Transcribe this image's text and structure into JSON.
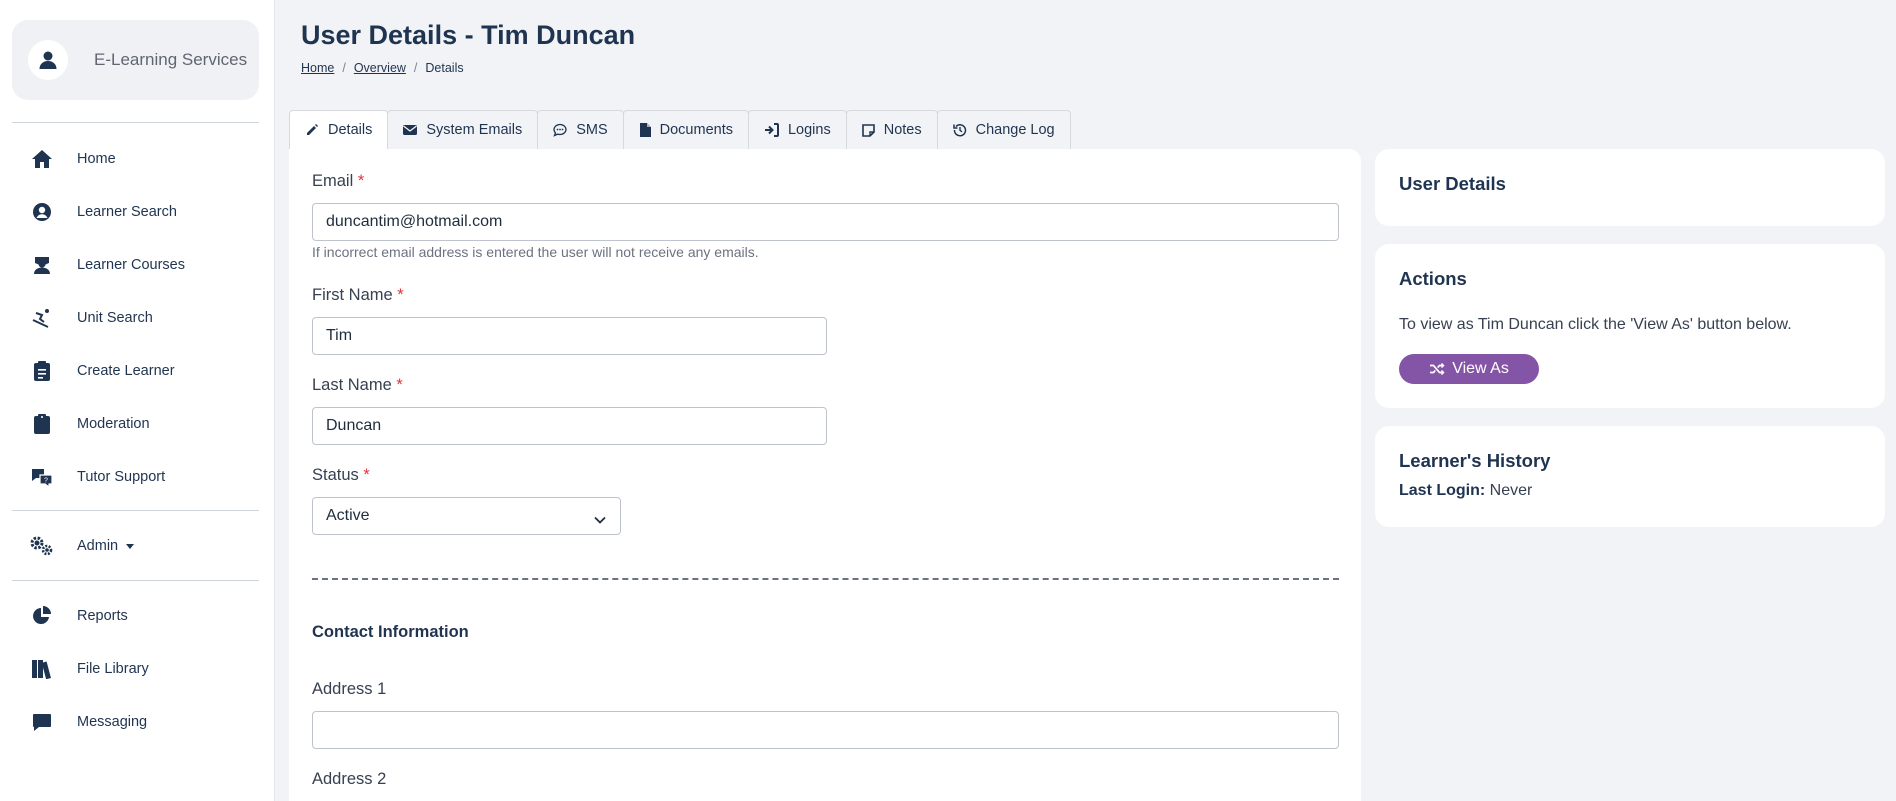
{
  "brand": {
    "name": "E-Learning Services",
    "icon": "user-icon"
  },
  "nav": {
    "items": [
      {
        "label": "Home",
        "icon": "home-icon"
      },
      {
        "label": "Learner Search",
        "icon": "user-circle-icon"
      },
      {
        "label": "Learner Courses",
        "icon": "graduate-icon"
      },
      {
        "label": "Unit Search",
        "icon": "skiing-icon"
      },
      {
        "label": "Create Learner",
        "icon": "clipboard-list-icon"
      },
      {
        "label": "Moderation",
        "icon": "clipboard-icon"
      },
      {
        "label": "Tutor Support",
        "icon": "comments-question-icon"
      },
      {
        "label": "Admin",
        "icon": "cogs-icon"
      },
      {
        "label": "Reports",
        "icon": "pie-chart-icon"
      },
      {
        "label": "File Library",
        "icon": "books-icon"
      },
      {
        "label": "Messaging",
        "icon": "message-icon"
      }
    ]
  },
  "header": {
    "title": "User Details - Tim Duncan",
    "breadcrumb": [
      "Home",
      "Overview",
      "Details"
    ],
    "breadcrumb_sep": "/"
  },
  "tabs": [
    {
      "label": "Details",
      "icon": "pencil-icon",
      "active": true
    },
    {
      "label": "System Emails",
      "icon": "envelope-icon"
    },
    {
      "label": "SMS",
      "icon": "comment-dots-icon"
    },
    {
      "label": "Documents",
      "icon": "file-icon"
    },
    {
      "label": "Logins",
      "icon": "sign-in-icon"
    },
    {
      "label": "Notes",
      "icon": "sticky-note-icon"
    },
    {
      "label": "Change Log",
      "icon": "history-icon"
    }
  ],
  "form": {
    "required_mark": "*",
    "email": {
      "label": "Email",
      "value": "duncantim@hotmail.com",
      "hint": "If incorrect email address is entered the user will not receive any emails."
    },
    "first_name": {
      "label": "First Name",
      "value": "Tim"
    },
    "last_name": {
      "label": "Last Name",
      "value": "Duncan"
    },
    "status": {
      "label": "Status",
      "value": "Active"
    },
    "contact_title": "Contact Information",
    "address1": {
      "label": "Address 1",
      "value": ""
    },
    "address2": {
      "label": "Address 2"
    }
  },
  "side": {
    "user_details_title": "User Details",
    "actions_title": "Actions",
    "actions_text": "To view as Tim Duncan click the 'View As' button below.",
    "view_as_label": "View As",
    "history_title": "Learner's History",
    "last_login_label": "Last Login:",
    "last_login_value": "Never"
  },
  "colors": {
    "accent": "#8454a6",
    "navy": "#1f3450",
    "required": "#e0343b"
  }
}
